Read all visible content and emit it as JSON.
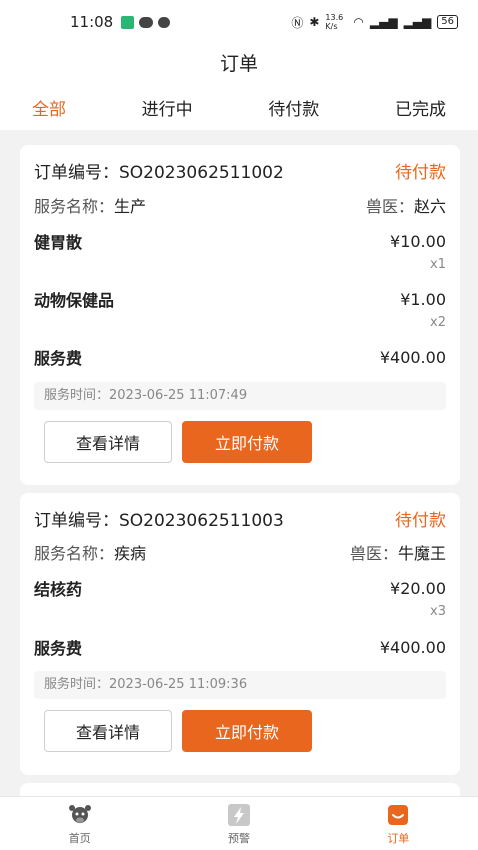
{
  "status_bar": {
    "time": "11:08",
    "network_speed": "13.6 K/s",
    "battery": "56"
  },
  "header": {
    "title": "订单"
  },
  "tabs": [
    {
      "label": "全部",
      "active": true
    },
    {
      "label": "进行中",
      "active": false
    },
    {
      "label": "待付款",
      "active": false
    },
    {
      "label": "已完成",
      "active": false
    }
  ],
  "orders": [
    {
      "order_label": "订单编号：",
      "order_no": "SO2023062511002",
      "status": "待付款",
      "service_label": "服务名称：",
      "service_name": "生产",
      "vet_label": "兽医：",
      "vet_name": "赵六",
      "items": [
        {
          "name": "健胃散",
          "price": "¥10.00",
          "qty": "x1"
        },
        {
          "name": "动物保健品",
          "price": "¥1.00",
          "qty": "x2"
        }
      ],
      "fee_label": "服务费",
      "fee": "¥400.00",
      "time_label": "服务时间：",
      "time": "2023-06-25 11:07:49",
      "detail_button": "查看详情",
      "pay_button": "立即付款"
    },
    {
      "order_label": "订单编号：",
      "order_no": "SO2023062511003",
      "status": "待付款",
      "service_label": "服务名称：",
      "service_name": "疾病",
      "vet_label": "兽医：",
      "vet_name": "牛魔王",
      "items": [
        {
          "name": "结核药",
          "price": "¥20.00",
          "qty": "x3"
        }
      ],
      "fee_label": "服务费",
      "fee": "¥400.00",
      "time_label": "服务时间：",
      "time": "2023-06-25 11:09:36",
      "detail_button": "查看详情",
      "pay_button": "立即付款"
    }
  ],
  "bottom_nav": [
    {
      "label": "首页",
      "icon": "cow-icon",
      "active": false
    },
    {
      "label": "预警",
      "icon": "lightning-icon",
      "active": false
    },
    {
      "label": "订单",
      "icon": "order-bag-icon",
      "active": true
    }
  ],
  "colors": {
    "accent": "#e8661e",
    "background": "#f2f2f2"
  }
}
